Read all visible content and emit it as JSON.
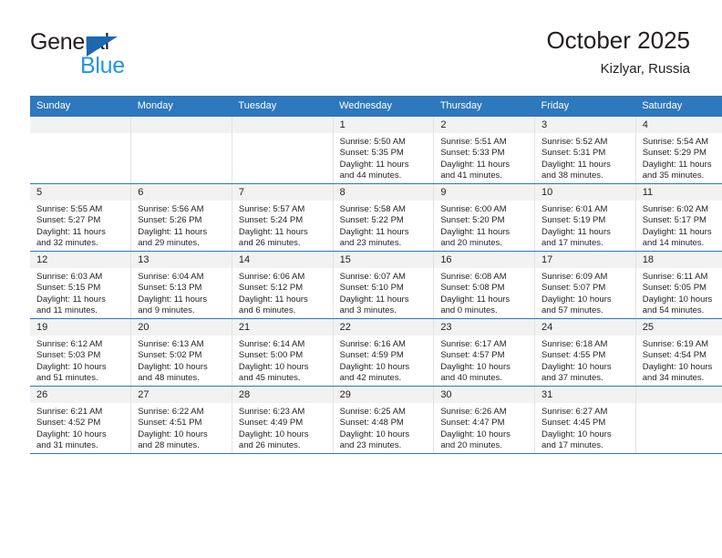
{
  "brand": {
    "name_part1": "General",
    "name_part2": "Blue",
    "logo_icon": "triangle-right-icon",
    "accent_color": "#1b68b3",
    "blue_text_color": "#2196e3"
  },
  "header": {
    "title": "October 2025",
    "subtitle": "Kizlyar, Russia"
  },
  "theme": {
    "header_row_bg": "#2e78bd",
    "daynum_bg": "#f2f2f2",
    "row_separator": "#2e78bd",
    "text_color": "#231f20"
  },
  "weekday_headers": [
    "Sunday",
    "Monday",
    "Tuesday",
    "Wednesday",
    "Thursday",
    "Friday",
    "Saturday"
  ],
  "weeks": [
    [
      {
        "day": "",
        "empty": true,
        "sunrise": "",
        "sunset": "",
        "daylight_line1": "",
        "daylight_line2": ""
      },
      {
        "day": "",
        "empty": true,
        "sunrise": "",
        "sunset": "",
        "daylight_line1": "",
        "daylight_line2": ""
      },
      {
        "day": "",
        "empty": true,
        "sunrise": "",
        "sunset": "",
        "daylight_line1": "",
        "daylight_line2": ""
      },
      {
        "day": "1",
        "empty": false,
        "sunrise": "Sunrise: 5:50 AM",
        "sunset": "Sunset: 5:35 PM",
        "daylight_line1": "Daylight: 11 hours",
        "daylight_line2": "and 44 minutes."
      },
      {
        "day": "2",
        "empty": false,
        "sunrise": "Sunrise: 5:51 AM",
        "sunset": "Sunset: 5:33 PM",
        "daylight_line1": "Daylight: 11 hours",
        "daylight_line2": "and 41 minutes."
      },
      {
        "day": "3",
        "empty": false,
        "sunrise": "Sunrise: 5:52 AM",
        "sunset": "Sunset: 5:31 PM",
        "daylight_line1": "Daylight: 11 hours",
        "daylight_line2": "and 38 minutes."
      },
      {
        "day": "4",
        "empty": false,
        "sunrise": "Sunrise: 5:54 AM",
        "sunset": "Sunset: 5:29 PM",
        "daylight_line1": "Daylight: 11 hours",
        "daylight_line2": "and 35 minutes."
      }
    ],
    [
      {
        "day": "5",
        "empty": false,
        "sunrise": "Sunrise: 5:55 AM",
        "sunset": "Sunset: 5:27 PM",
        "daylight_line1": "Daylight: 11 hours",
        "daylight_line2": "and 32 minutes."
      },
      {
        "day": "6",
        "empty": false,
        "sunrise": "Sunrise: 5:56 AM",
        "sunset": "Sunset: 5:26 PM",
        "daylight_line1": "Daylight: 11 hours",
        "daylight_line2": "and 29 minutes."
      },
      {
        "day": "7",
        "empty": false,
        "sunrise": "Sunrise: 5:57 AM",
        "sunset": "Sunset: 5:24 PM",
        "daylight_line1": "Daylight: 11 hours",
        "daylight_line2": "and 26 minutes."
      },
      {
        "day": "8",
        "empty": false,
        "sunrise": "Sunrise: 5:58 AM",
        "sunset": "Sunset: 5:22 PM",
        "daylight_line1": "Daylight: 11 hours",
        "daylight_line2": "and 23 minutes."
      },
      {
        "day": "9",
        "empty": false,
        "sunrise": "Sunrise: 6:00 AM",
        "sunset": "Sunset: 5:20 PM",
        "daylight_line1": "Daylight: 11 hours",
        "daylight_line2": "and 20 minutes."
      },
      {
        "day": "10",
        "empty": false,
        "sunrise": "Sunrise: 6:01 AM",
        "sunset": "Sunset: 5:19 PM",
        "daylight_line1": "Daylight: 11 hours",
        "daylight_line2": "and 17 minutes."
      },
      {
        "day": "11",
        "empty": false,
        "sunrise": "Sunrise: 6:02 AM",
        "sunset": "Sunset: 5:17 PM",
        "daylight_line1": "Daylight: 11 hours",
        "daylight_line2": "and 14 minutes."
      }
    ],
    [
      {
        "day": "12",
        "empty": false,
        "sunrise": "Sunrise: 6:03 AM",
        "sunset": "Sunset: 5:15 PM",
        "daylight_line1": "Daylight: 11 hours",
        "daylight_line2": "and 11 minutes."
      },
      {
        "day": "13",
        "empty": false,
        "sunrise": "Sunrise: 6:04 AM",
        "sunset": "Sunset: 5:13 PM",
        "daylight_line1": "Daylight: 11 hours",
        "daylight_line2": "and 9 minutes."
      },
      {
        "day": "14",
        "empty": false,
        "sunrise": "Sunrise: 6:06 AM",
        "sunset": "Sunset: 5:12 PM",
        "daylight_line1": "Daylight: 11 hours",
        "daylight_line2": "and 6 minutes."
      },
      {
        "day": "15",
        "empty": false,
        "sunrise": "Sunrise: 6:07 AM",
        "sunset": "Sunset: 5:10 PM",
        "daylight_line1": "Daylight: 11 hours",
        "daylight_line2": "and 3 minutes."
      },
      {
        "day": "16",
        "empty": false,
        "sunrise": "Sunrise: 6:08 AM",
        "sunset": "Sunset: 5:08 PM",
        "daylight_line1": "Daylight: 11 hours",
        "daylight_line2": "and 0 minutes."
      },
      {
        "day": "17",
        "empty": false,
        "sunrise": "Sunrise: 6:09 AM",
        "sunset": "Sunset: 5:07 PM",
        "daylight_line1": "Daylight: 10 hours",
        "daylight_line2": "and 57 minutes."
      },
      {
        "day": "18",
        "empty": false,
        "sunrise": "Sunrise: 6:11 AM",
        "sunset": "Sunset: 5:05 PM",
        "daylight_line1": "Daylight: 10 hours",
        "daylight_line2": "and 54 minutes."
      }
    ],
    [
      {
        "day": "19",
        "empty": false,
        "sunrise": "Sunrise: 6:12 AM",
        "sunset": "Sunset: 5:03 PM",
        "daylight_line1": "Daylight: 10 hours",
        "daylight_line2": "and 51 minutes."
      },
      {
        "day": "20",
        "empty": false,
        "sunrise": "Sunrise: 6:13 AM",
        "sunset": "Sunset: 5:02 PM",
        "daylight_line1": "Daylight: 10 hours",
        "daylight_line2": "and 48 minutes."
      },
      {
        "day": "21",
        "empty": false,
        "sunrise": "Sunrise: 6:14 AM",
        "sunset": "Sunset: 5:00 PM",
        "daylight_line1": "Daylight: 10 hours",
        "daylight_line2": "and 45 minutes."
      },
      {
        "day": "22",
        "empty": false,
        "sunrise": "Sunrise: 6:16 AM",
        "sunset": "Sunset: 4:59 PM",
        "daylight_line1": "Daylight: 10 hours",
        "daylight_line2": "and 42 minutes."
      },
      {
        "day": "23",
        "empty": false,
        "sunrise": "Sunrise: 6:17 AM",
        "sunset": "Sunset: 4:57 PM",
        "daylight_line1": "Daylight: 10 hours",
        "daylight_line2": "and 40 minutes."
      },
      {
        "day": "24",
        "empty": false,
        "sunrise": "Sunrise: 6:18 AM",
        "sunset": "Sunset: 4:55 PM",
        "daylight_line1": "Daylight: 10 hours",
        "daylight_line2": "and 37 minutes."
      },
      {
        "day": "25",
        "empty": false,
        "sunrise": "Sunrise: 6:19 AM",
        "sunset": "Sunset: 4:54 PM",
        "daylight_line1": "Daylight: 10 hours",
        "daylight_line2": "and 34 minutes."
      }
    ],
    [
      {
        "day": "26",
        "empty": false,
        "sunrise": "Sunrise: 6:21 AM",
        "sunset": "Sunset: 4:52 PM",
        "daylight_line1": "Daylight: 10 hours",
        "daylight_line2": "and 31 minutes."
      },
      {
        "day": "27",
        "empty": false,
        "sunrise": "Sunrise: 6:22 AM",
        "sunset": "Sunset: 4:51 PM",
        "daylight_line1": "Daylight: 10 hours",
        "daylight_line2": "and 28 minutes."
      },
      {
        "day": "28",
        "empty": false,
        "sunrise": "Sunrise: 6:23 AM",
        "sunset": "Sunset: 4:49 PM",
        "daylight_line1": "Daylight: 10 hours",
        "daylight_line2": "and 26 minutes."
      },
      {
        "day": "29",
        "empty": false,
        "sunrise": "Sunrise: 6:25 AM",
        "sunset": "Sunset: 4:48 PM",
        "daylight_line1": "Daylight: 10 hours",
        "daylight_line2": "and 23 minutes."
      },
      {
        "day": "30",
        "empty": false,
        "sunrise": "Sunrise: 6:26 AM",
        "sunset": "Sunset: 4:47 PM",
        "daylight_line1": "Daylight: 10 hours",
        "daylight_line2": "and 20 minutes."
      },
      {
        "day": "31",
        "empty": false,
        "sunrise": "Sunrise: 6:27 AM",
        "sunset": "Sunset: 4:45 PM",
        "daylight_line1": "Daylight: 10 hours",
        "daylight_line2": "and 17 minutes."
      },
      {
        "day": "",
        "empty": true,
        "sunrise": "",
        "sunset": "",
        "daylight_line1": "",
        "daylight_line2": ""
      }
    ]
  ]
}
